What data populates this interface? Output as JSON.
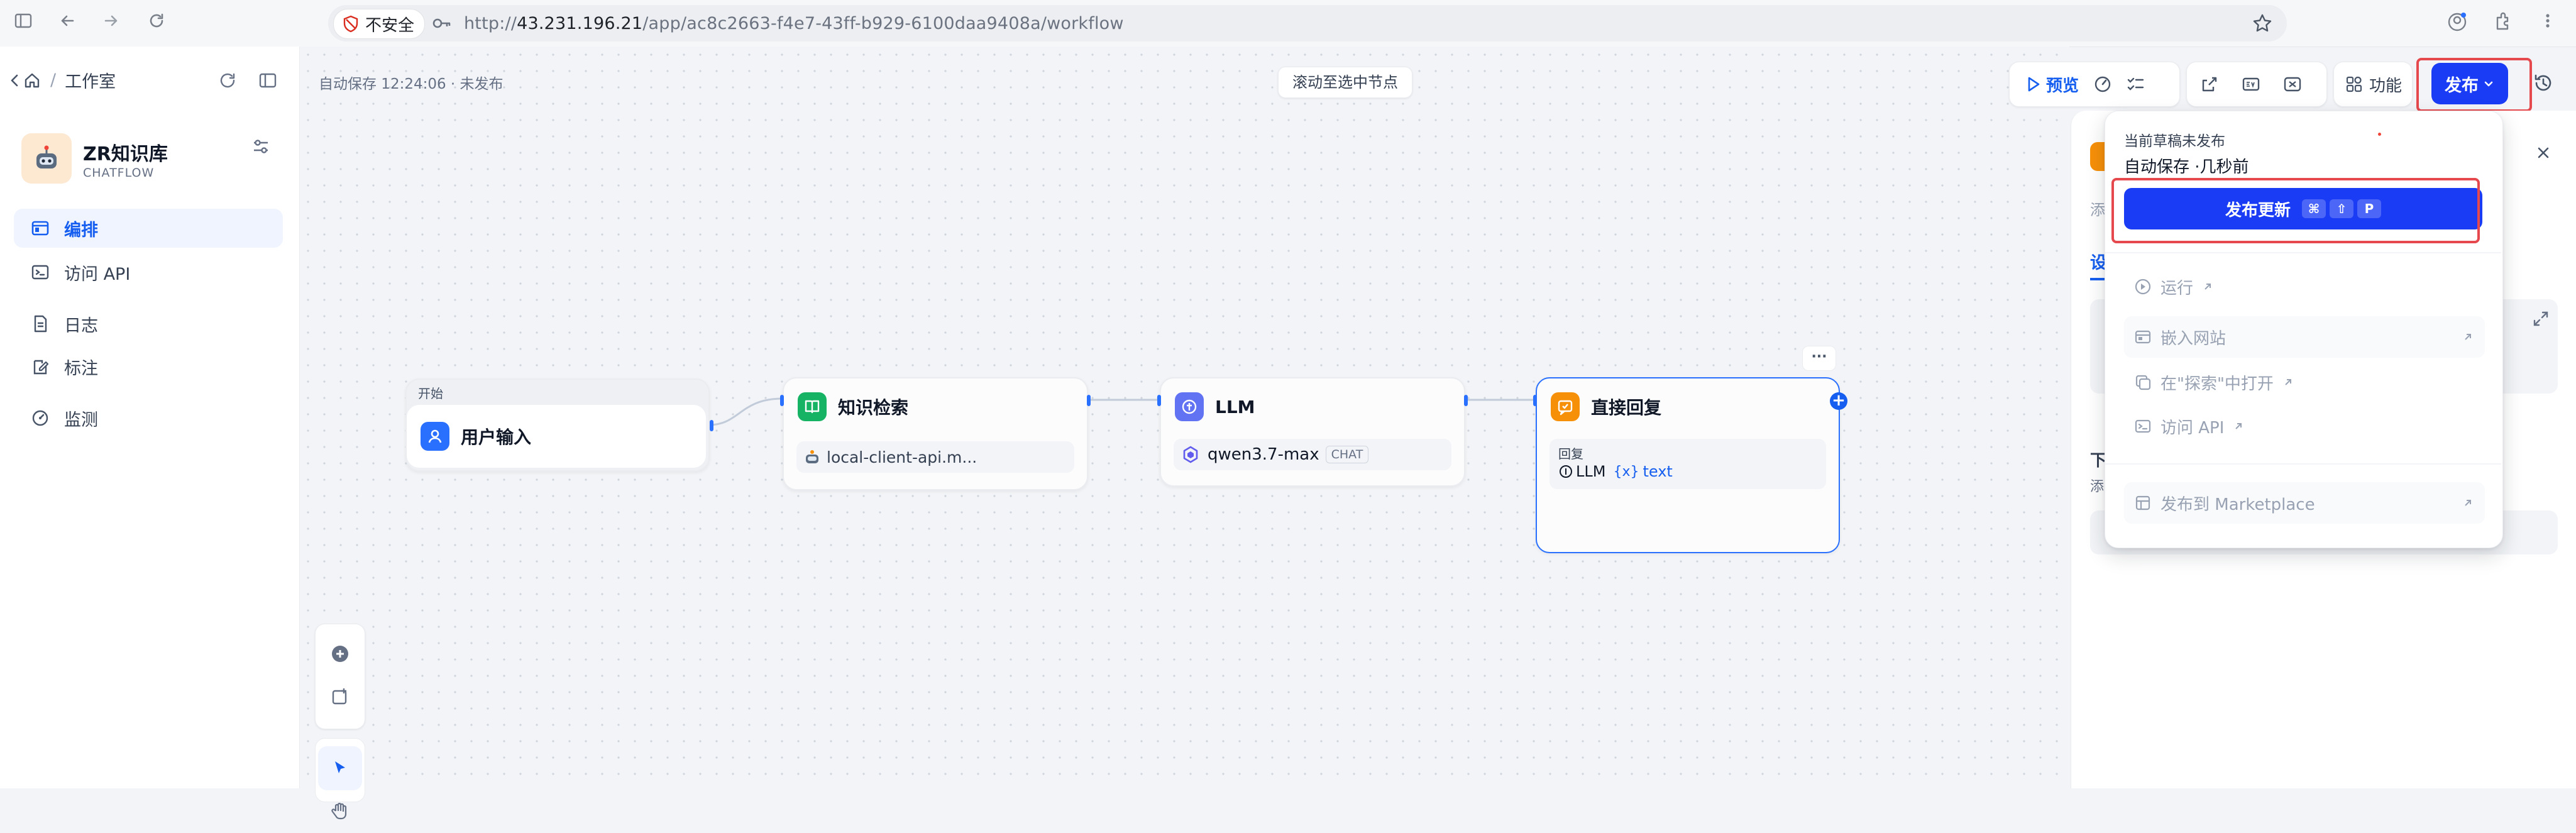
{
  "browser": {
    "insecure_label": "不安全",
    "url_prefix": "http://",
    "url_host": "43.231.196.21",
    "url_path": "/app/ac8c2663-f4e7-43ff-b929-6100daa9408a/workflow"
  },
  "sidebar": {
    "breadcrumb": "工作室",
    "app_name": "ZR知识库",
    "app_type": "CHATFLOW",
    "items": [
      {
        "label": "编排",
        "active": true
      },
      {
        "label": "访问 API",
        "active": false
      },
      {
        "label": "日志",
        "active": false
      },
      {
        "label": "标注",
        "active": false
      },
      {
        "label": "监测",
        "active": false
      }
    ]
  },
  "canvas": {
    "autosave_status": "自动保存 12:24:06 · 未发布",
    "scroll_to_selected": "滚动至选中节点",
    "nodes": {
      "start": {
        "group_label": "开始",
        "title": "用户输入"
      },
      "knowledge": {
        "title": "知识检索",
        "dataset": "local-client-api.m..."
      },
      "llm": {
        "title": "LLM",
        "model": "qwen3.7-max",
        "model_badge": "CHAT"
      },
      "answer": {
        "title": "直接回复",
        "field_label": "回复",
        "var_source": "LLM",
        "var_name": "text"
      }
    },
    "more_glyph": "···"
  },
  "toolbar": {
    "preview": "预览",
    "features": "功能",
    "publish": "发布"
  },
  "right_panel": {
    "frag_1": "添",
    "frag_2": "设",
    "frag_3": "下",
    "frag_4": "添"
  },
  "publish_menu": {
    "draft_status": "当前草稿未发布",
    "autosave": "自动保存 ·几秒前",
    "publish_update": "发布更新",
    "shortcut": [
      "⌘",
      "⇧",
      "P"
    ],
    "items": [
      "运行",
      "嵌入网站",
      "在\"探索\"中打开",
      "访问 API",
      "发布到 Marketplace"
    ]
  },
  "colors": {
    "primary": "#155eef",
    "publish_button": "#1a3cf5",
    "highlight_box": "#e5484d",
    "knowledge_icon": "#16b364",
    "llm_icon": "#6172f3",
    "answer_icon": "#f79009",
    "start_icon": "#2970ff"
  }
}
